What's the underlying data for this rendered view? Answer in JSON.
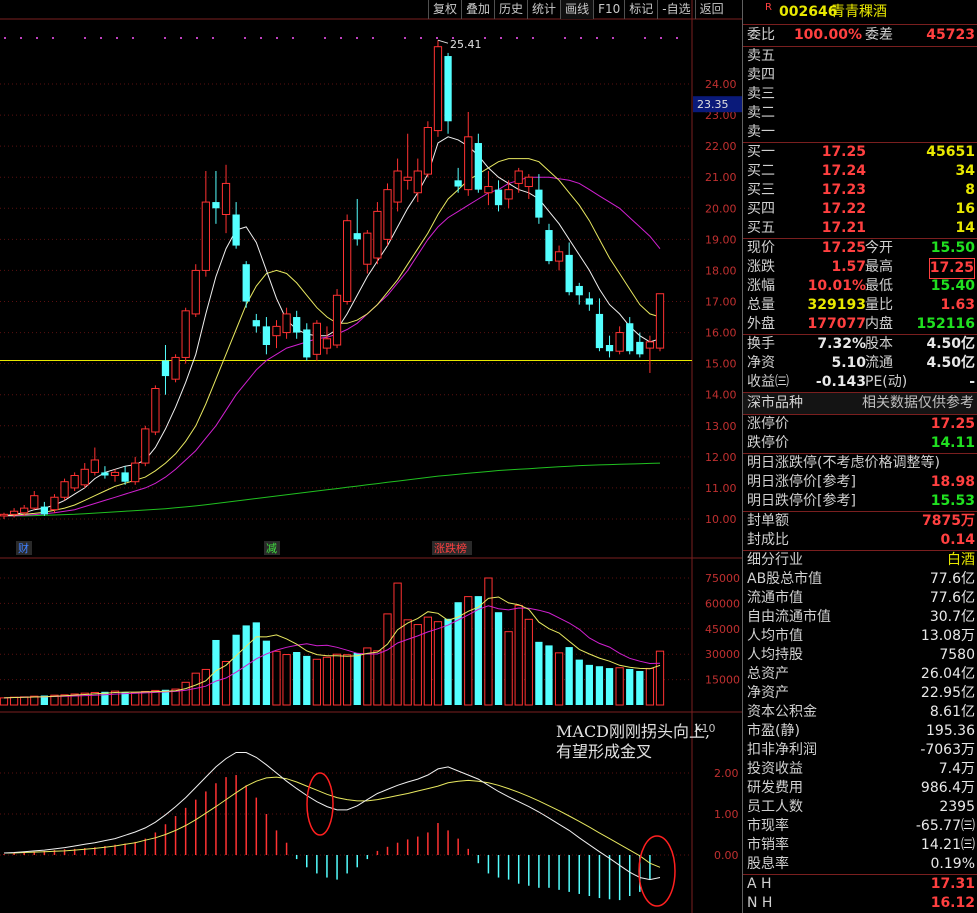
{
  "toolbar": [
    "复权",
    "叠加",
    "历史",
    "统计",
    "画线",
    "F10",
    "标记",
    "-自选",
    "返回"
  ],
  "toolbar_active": "画线",
  "stock": {
    "flag": "R",
    "code": "002646",
    "name": "青青稞酒"
  },
  "price_axis": [
    "24.00",
    "23.00",
    "22.00",
    "21.00",
    "20.00",
    "19.00",
    "18.00",
    "17.00",
    "16.00",
    "15.00",
    "14.00",
    "13.00",
    "12.00",
    "11.00",
    "10.00"
  ],
  "price_marker": "23.35",
  "high_label": "25.41",
  "event_tags": [
    {
      "text": "财",
      "color": "#4080ff"
    },
    {
      "text": "减",
      "color": "#40e040"
    },
    {
      "text": "涨跌榜",
      "color": "#ff4040"
    }
  ],
  "volume_axis": [
    "75000",
    "60000",
    "45000",
    "30000",
    "15000"
  ],
  "volume_unit": "X10",
  "macd_axis": [
    "2.00",
    "1.00",
    "0.00"
  ],
  "annotation": [
    "MACD刚刚拐头向上,",
    "有望形成金叉"
  ],
  "chart_data": {
    "type": "candlestick",
    "ylim": [
      9.7,
      25.8
    ],
    "reference_line": 15.1,
    "candles": [
      {
        "o": 10.1,
        "h": 10.2,
        "l": 10.0,
        "c": 10.15
      },
      {
        "o": 10.15,
        "h": 10.35,
        "l": 10.05,
        "c": 10.25
      },
      {
        "o": 10.2,
        "h": 10.45,
        "l": 10.1,
        "c": 10.35
      },
      {
        "o": 10.35,
        "h": 10.9,
        "l": 10.3,
        "c": 10.75
      },
      {
        "o": 10.4,
        "h": 10.55,
        "l": 10.1,
        "c": 10.15
      },
      {
        "o": 10.3,
        "h": 10.8,
        "l": 10.2,
        "c": 10.7
      },
      {
        "o": 10.7,
        "h": 11.3,
        "l": 10.6,
        "c": 11.2
      },
      {
        "o": 11.0,
        "h": 11.5,
        "l": 10.9,
        "c": 11.4
      },
      {
        "o": 11.1,
        "h": 11.8,
        "l": 11.0,
        "c": 11.6
      },
      {
        "o": 11.5,
        "h": 12.3,
        "l": 11.4,
        "c": 11.9
      },
      {
        "o": 11.5,
        "h": 11.7,
        "l": 11.3,
        "c": 11.4
      },
      {
        "o": 11.4,
        "h": 11.6,
        "l": 11.2,
        "c": 11.5
      },
      {
        "o": 11.5,
        "h": 11.7,
        "l": 11.1,
        "c": 11.2
      },
      {
        "o": 11.2,
        "h": 12.0,
        "l": 11.1,
        "c": 11.8
      },
      {
        "o": 11.8,
        "h": 13.0,
        "l": 11.7,
        "c": 12.9
      },
      {
        "o": 12.8,
        "h": 14.3,
        "l": 12.7,
        "c": 14.2
      },
      {
        "o": 15.1,
        "h": 15.6,
        "l": 14.0,
        "c": 14.6
      },
      {
        "o": 14.5,
        "h": 15.3,
        "l": 14.4,
        "c": 15.2
      },
      {
        "o": 15.2,
        "h": 16.8,
        "l": 15.0,
        "c": 16.7
      },
      {
        "o": 16.6,
        "h": 18.2,
        "l": 16.5,
        "c": 18.0
      },
      {
        "o": 18.0,
        "h": 21.2,
        "l": 17.8,
        "c": 20.2
      },
      {
        "o": 20.2,
        "h": 21.2,
        "l": 19.5,
        "c": 20.0
      },
      {
        "o": 19.8,
        "h": 21.4,
        "l": 19.2,
        "c": 20.8
      },
      {
        "o": 19.8,
        "h": 20.2,
        "l": 18.7,
        "c": 18.8
      },
      {
        "o": 18.2,
        "h": 18.3,
        "l": 16.8,
        "c": 17.0
      },
      {
        "o": 16.4,
        "h": 16.6,
        "l": 16.0,
        "c": 16.2
      },
      {
        "o": 16.2,
        "h": 16.5,
        "l": 15.3,
        "c": 15.6
      },
      {
        "o": 15.9,
        "h": 16.4,
        "l": 15.5,
        "c": 16.2
      },
      {
        "o": 16.0,
        "h": 16.8,
        "l": 15.8,
        "c": 16.6
      },
      {
        "o": 16.5,
        "h": 16.7,
        "l": 15.8,
        "c": 16.0
      },
      {
        "o": 16.1,
        "h": 16.3,
        "l": 15.1,
        "c": 15.2
      },
      {
        "o": 15.3,
        "h": 16.4,
        "l": 15.1,
        "c": 16.3
      },
      {
        "o": 15.5,
        "h": 16.2,
        "l": 15.3,
        "c": 15.8
      },
      {
        "o": 15.6,
        "h": 17.4,
        "l": 15.5,
        "c": 17.2
      },
      {
        "o": 17.0,
        "h": 19.8,
        "l": 16.9,
        "c": 19.6
      },
      {
        "o": 19.2,
        "h": 20.3,
        "l": 18.8,
        "c": 19.0
      },
      {
        "o": 18.2,
        "h": 19.3,
        "l": 17.9,
        "c": 19.2
      },
      {
        "o": 18.4,
        "h": 20.2,
        "l": 18.2,
        "c": 19.9
      },
      {
        "o": 19.0,
        "h": 20.8,
        "l": 18.8,
        "c": 20.6
      },
      {
        "o": 20.2,
        "h": 21.6,
        "l": 19.9,
        "c": 21.2
      },
      {
        "o": 20.9,
        "h": 22.4,
        "l": 20.6,
        "c": 21.0
      },
      {
        "o": 20.5,
        "h": 21.6,
        "l": 20.2,
        "c": 21.2
      },
      {
        "o": 21.1,
        "h": 22.8,
        "l": 21.0,
        "c": 22.6
      },
      {
        "o": 22.5,
        "h": 25.41,
        "l": 22.3,
        "c": 25.2
      },
      {
        "o": 24.9,
        "h": 25.0,
        "l": 22.4,
        "c": 22.8
      },
      {
        "o": 20.9,
        "h": 21.3,
        "l": 20.5,
        "c": 20.7
      },
      {
        "o": 20.6,
        "h": 23.1,
        "l": 20.4,
        "c": 22.3
      },
      {
        "o": 22.1,
        "h": 22.4,
        "l": 20.5,
        "c": 20.6
      },
      {
        "o": 20.5,
        "h": 21.2,
        "l": 20.1,
        "c": 20.7
      },
      {
        "o": 20.6,
        "h": 20.9,
        "l": 19.9,
        "c": 20.1
      },
      {
        "o": 20.3,
        "h": 20.9,
        "l": 20.0,
        "c": 20.6
      },
      {
        "o": 20.8,
        "h": 21.3,
        "l": 20.5,
        "c": 21.2
      },
      {
        "o": 20.7,
        "h": 21.1,
        "l": 20.3,
        "c": 21.0
      },
      {
        "o": 20.6,
        "h": 21.1,
        "l": 19.5,
        "c": 19.7
      },
      {
        "o": 19.3,
        "h": 19.5,
        "l": 18.2,
        "c": 18.3
      },
      {
        "o": 18.3,
        "h": 18.8,
        "l": 18.0,
        "c": 18.6
      },
      {
        "o": 18.5,
        "h": 18.9,
        "l": 17.2,
        "c": 17.3
      },
      {
        "o": 17.5,
        "h": 17.6,
        "l": 16.9,
        "c": 17.2
      },
      {
        "o": 17.1,
        "h": 17.3,
        "l": 16.7,
        "c": 16.9
      },
      {
        "o": 16.6,
        "h": 17.1,
        "l": 15.4,
        "c": 15.5
      },
      {
        "o": 15.6,
        "h": 15.9,
        "l": 15.2,
        "c": 15.4
      },
      {
        "o": 15.4,
        "h": 16.2,
        "l": 15.3,
        "c": 16.0
      },
      {
        "o": 16.3,
        "h": 16.5,
        "l": 15.3,
        "c": 15.4
      },
      {
        "o": 15.7,
        "h": 16.0,
        "l": 15.2,
        "c": 15.3
      },
      {
        "o": 15.5,
        "h": 15.9,
        "l": 14.7,
        "c": 15.7
      },
      {
        "o": 15.5,
        "h": 17.25,
        "l": 15.4,
        "c": 17.25
      }
    ],
    "ma_white": [
      10.1,
      10.15,
      10.2,
      10.3,
      10.35,
      10.45,
      10.6,
      10.8,
      11.0,
      11.3,
      11.5,
      11.6,
      11.7,
      11.75,
      11.9,
      12.3,
      12.9,
      13.6,
      14.4,
      15.3,
      16.6,
      17.8,
      18.7,
      19.3,
      19.4,
      18.9,
      18.0,
      17.1,
      16.4,
      16.1,
      15.95,
      15.9,
      15.9,
      16.1,
      16.6,
      17.2,
      17.8,
      18.3,
      18.8,
      19.4,
      20.0,
      20.5,
      21.1,
      22.1,
      22.3,
      22.2,
      22.0,
      21.7,
      21.3,
      21.0,
      20.8,
      20.6,
      20.5,
      20.3,
      19.9,
      19.5,
      19.0,
      18.5,
      18.0,
      17.4,
      16.9,
      16.6,
      16.2,
      15.9,
      15.7,
      15.8
    ],
    "ma_yellow": [
      10.1,
      10.12,
      10.15,
      10.18,
      10.22,
      10.28,
      10.35,
      10.45,
      10.6,
      10.75,
      10.9,
      11.05,
      11.15,
      11.25,
      11.35,
      11.55,
      11.8,
      12.1,
      12.5,
      13.0,
      13.7,
      14.5,
      15.3,
      16.1,
      16.9,
      17.5,
      17.9,
      18.0,
      17.9,
      17.6,
      17.2,
      16.8,
      16.5,
      16.3,
      16.3,
      16.4,
      16.6,
      16.9,
      17.3,
      17.7,
      18.2,
      18.7,
      19.2,
      19.8,
      20.3,
      20.6,
      20.9,
      21.1,
      21.3,
      21.5,
      21.6,
      21.6,
      21.6,
      21.5,
      21.2,
      20.9,
      20.5,
      20.1,
      19.6,
      19.0,
      18.4,
      17.9,
      17.4,
      16.9,
      16.6,
      16.5
    ],
    "ma_magenta": [
      10.1,
      10.1,
      10.12,
      10.14,
      10.17,
      10.2,
      10.25,
      10.3,
      10.4,
      10.5,
      10.6,
      10.7,
      10.8,
      10.9,
      11.0,
      11.15,
      11.35,
      11.6,
      11.9,
      12.2,
      12.6,
      13.0,
      13.5,
      14.0,
      14.4,
      14.8,
      15.1,
      15.3,
      15.5,
      15.6,
      15.7,
      15.8,
      15.85,
      15.95,
      16.1,
      16.3,
      16.6,
      16.9,
      17.2,
      17.6,
      18.0,
      18.5,
      19.0,
      19.4,
      19.7,
      19.9,
      20.1,
      20.3,
      20.5,
      20.6,
      20.8,
      20.9,
      21.0,
      21.0,
      21.0,
      20.95,
      20.9,
      20.8,
      20.6,
      20.4,
      20.2,
      20.0,
      19.7,
      19.4,
      19.1,
      18.7
    ],
    "ma_green": [
      10.1,
      10.1,
      10.1,
      10.11,
      10.12,
      10.13,
      10.14,
      10.15,
      10.17,
      10.19,
      10.21,
      10.23,
      10.25,
      10.27,
      10.29,
      10.31,
      10.33,
      10.36,
      10.39,
      10.42,
      10.46,
      10.5,
      10.54,
      10.58,
      10.62,
      10.66,
      10.7,
      10.74,
      10.78,
      10.82,
      10.86,
      10.9,
      10.94,
      10.98,
      11.02,
      11.06,
      11.1,
      11.14,
      11.18,
      11.22,
      11.26,
      11.3,
      11.34,
      11.38,
      11.41,
      11.44,
      11.47,
      11.5,
      11.53,
      11.56,
      11.58,
      11.6,
      11.62,
      11.64,
      11.66,
      11.68,
      11.7,
      11.72,
      11.73,
      11.74,
      11.75,
      11.76,
      11.77,
      11.78,
      11.79,
      11.8
    ],
    "volume": [
      4200,
      4600,
      4800,
      5200,
      5600,
      5800,
      6000,
      6500,
      7000,
      7400,
      7800,
      8200,
      7600,
      7200,
      8000,
      8600,
      9000,
      9400,
      13400,
      18800,
      21000,
      38400,
      25700,
      41500,
      47000,
      48800,
      38000,
      31700,
      29800,
      31300,
      29000,
      27000,
      28200,
      30000,
      29700,
      30700,
      33700,
      32000,
      53800,
      72000,
      50300,
      47500,
      51900,
      49200,
      50900,
      60700,
      64000,
      64300,
      75000,
      54800,
      43300,
      58800,
      50600,
      37300,
      35200,
      30800,
      34200,
      26800,
      23700,
      22900,
      21800,
      22000,
      21300,
      20100,
      21600,
      31800,
      26100,
      22900
    ],
    "macd_hist": [
      0.02,
      0.04,
      0.06,
      0.08,
      0.1,
      0.12,
      0.14,
      0.15,
      0.17,
      0.19,
      0.22,
      0.25,
      0.28,
      0.32,
      0.4,
      0.55,
      0.75,
      0.95,
      1.15,
      1.35,
      1.55,
      1.75,
      1.9,
      1.95,
      1.7,
      1.4,
      1.0,
      0.6,
      0.3,
      -0.1,
      -0.3,
      -0.45,
      -0.55,
      -0.6,
      -0.45,
      -0.3,
      -0.1,
      0.1,
      0.2,
      0.3,
      0.38,
      0.45,
      0.55,
      0.78,
      0.6,
      0.4,
      0.15,
      -0.2,
      -0.45,
      -0.55,
      -0.6,
      -0.7,
      -0.75,
      -0.8,
      -0.8,
      -0.85,
      -0.9,
      -0.95,
      -1.0,
      -1.05,
      -1.08,
      -1.1,
      -1.0,
      -0.9,
      -0.6
    ],
    "macd_dif": [
      0.05,
      0.06,
      0.08,
      0.1,
      0.12,
      0.15,
      0.18,
      0.22,
      0.26,
      0.3,
      0.35,
      0.4,
      0.48,
      0.56,
      0.66,
      0.8,
      0.98,
      1.18,
      1.4,
      1.65,
      1.9,
      2.15,
      2.35,
      2.5,
      2.5,
      2.38,
      2.2,
      2.0,
      1.8,
      1.62,
      1.45,
      1.3,
      1.18,
      1.1,
      1.1,
      1.2,
      1.35,
      1.5,
      1.6,
      1.7,
      1.78,
      1.85,
      1.95,
      2.1,
      2.15,
      2.05,
      1.95,
      1.85,
      1.7,
      1.55,
      1.42,
      1.3,
      1.18,
      1.05,
      0.9,
      0.75,
      0.6,
      0.42,
      0.25,
      0.08,
      -0.08,
      -0.25,
      -0.42,
      -0.55,
      -0.6,
      -0.55
    ],
    "macd_dea": [
      0.05,
      0.05,
      0.06,
      0.07,
      0.08,
      0.09,
      0.1,
      0.12,
      0.14,
      0.16,
      0.19,
      0.22,
      0.26,
      0.3,
      0.36,
      0.42,
      0.5,
      0.6,
      0.72,
      0.86,
      1.02,
      1.18,
      1.35,
      1.52,
      1.68,
      1.8,
      1.88,
      1.9,
      1.86,
      1.78,
      1.68,
      1.58,
      1.48,
      1.4,
      1.35,
      1.32,
      1.32,
      1.35,
      1.4,
      1.45,
      1.5,
      1.56,
      1.62,
      1.68,
      1.76,
      1.8,
      1.82,
      1.8,
      1.76,
      1.7,
      1.62,
      1.53,
      1.43,
      1.32,
      1.2,
      1.08,
      0.95,
      0.82,
      0.68,
      0.54,
      0.4,
      0.26,
      0.12,
      -0.02,
      -0.2,
      -0.3
    ]
  },
  "panel": {
    "wei": {
      "label1": "委比",
      "val1": "100.00%",
      "label2": "委差",
      "val2": "45723"
    },
    "sell": [
      "卖五",
      "卖四",
      "卖三",
      "卖二",
      "卖一"
    ],
    "buy": [
      {
        "label": "买一",
        "price": "17.25",
        "vol": "45651"
      },
      {
        "label": "买二",
        "price": "17.24",
        "vol": "34"
      },
      {
        "label": "买三",
        "price": "17.23",
        "vol": "8"
      },
      {
        "label": "买四",
        "price": "17.22",
        "vol": "16"
      },
      {
        "label": "买五",
        "price": "17.21",
        "vol": "14"
      }
    ],
    "quote": [
      {
        "l1": "现价",
        "v1": "17.25",
        "c1": "red",
        "l2": "今开",
        "v2": "15.50",
        "c2": "green"
      },
      {
        "l1": "涨跌",
        "v1": "1.57",
        "c1": "red",
        "l2": "最高",
        "v2": "17.25",
        "c2": "red"
      },
      {
        "l1": "涨幅",
        "v1": "10.01%",
        "c1": "red",
        "l2": "最低",
        "v2": "15.40",
        "c2": "green"
      },
      {
        "l1": "总量",
        "v1": "329193",
        "c1": "yellow",
        "l2": "量比",
        "v2": "1.63",
        "c2": "red"
      },
      {
        "l1": "外盘",
        "v1": "177077",
        "c1": "red",
        "l2": "内盘",
        "v2": "152116",
        "c2": "green"
      }
    ],
    "stats": [
      {
        "l1": "换手",
        "v1": "7.32%",
        "l2": "股本",
        "v2": "4.50亿"
      },
      {
        "l1": "净资",
        "v1": "5.10",
        "l2": "流通",
        "v2": "4.50亿"
      },
      {
        "l1": "收益㈢",
        "v1": "-0.143",
        "l2": "PE(动)",
        "v2": "-"
      }
    ],
    "market": {
      "label": "深市品种",
      "note": "相关数据仅供参考"
    },
    "limits": [
      {
        "label": "涨停价",
        "val": "17.25",
        "color": "red"
      },
      {
        "label": "跌停价",
        "val": "14.11",
        "color": "green"
      }
    ],
    "tomorrow": {
      "title": "明日涨跌停(不考虑价格调整等)",
      "up_label": "明日涨停价[参考]",
      "up_val": "18.98",
      "down_label": "明日跌停价[参考]",
      "down_val": "15.53"
    },
    "seal": [
      {
        "label": "封单额",
        "val": "7875万",
        "color": "red"
      },
      {
        "label": "封成比",
        "val": "0.14",
        "color": "red"
      }
    ],
    "industry": {
      "label": "细分行业",
      "val": "白酒"
    },
    "fundamentals": [
      {
        "label": "AB股总市值",
        "val": "77.6亿"
      },
      {
        "label": "流通市值",
        "val": "77.6亿"
      },
      {
        "label": "自由流通市值",
        "val": "30.7亿"
      },
      {
        "label": "人均市值",
        "val": "13.08万"
      },
      {
        "label": "人均持股",
        "val": "7580"
      },
      {
        "label": "总资产",
        "val": "26.04亿"
      },
      {
        "label": "净资产",
        "val": "22.95亿"
      },
      {
        "label": "资本公积金",
        "val": "8.61亿"
      },
      {
        "label": "市盈(静)",
        "val": "195.36"
      },
      {
        "label": "扣非净利润",
        "val": "-7063万"
      },
      {
        "label": "投资收益",
        "val": "7.4万"
      },
      {
        "label": "研发费用",
        "val": "986.4万"
      },
      {
        "label": "员工人数",
        "val": "2395"
      },
      {
        "label": "市现率",
        "val": "-65.77㈢"
      },
      {
        "label": "市销率",
        "val": "14.21㈢"
      },
      {
        "label": "股息率",
        "val": "0.19%"
      }
    ],
    "ah": {
      "label": "A H",
      "val": "17.31"
    },
    "nh": {
      "label": "N H",
      "val": "16.12"
    }
  }
}
